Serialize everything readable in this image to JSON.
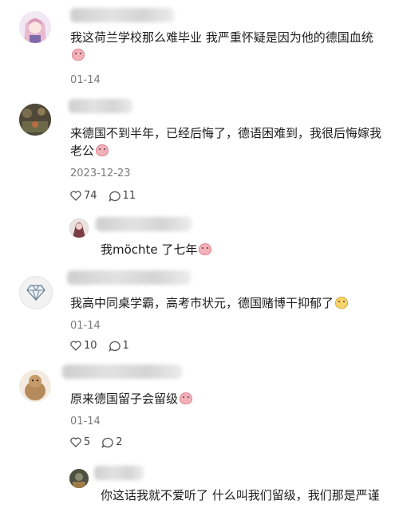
{
  "comments": [
    {
      "text": "我这荷兰学校那么难毕业 我严重怀疑是因为他的德国血统",
      "date": "01-14"
    },
    {
      "text": "来德国不到半年，已经后悔了，德语困难到，我很后悔嫁我老公",
      "date": "2023-12-23",
      "likes": "74",
      "replies": "11"
    },
    {
      "text": "我möchte 了七年"
    },
    {
      "text": "我高中同桌学霸，高考市状元，德国赌博干抑郁了",
      "date": "01-14",
      "likes": "10",
      "replies": "1"
    },
    {
      "text": "原来德国留子会留级",
      "date": "01-14",
      "likes": "5",
      "replies": "2"
    },
    {
      "text": "你这话我就不爱听了 什么叫我们留级，我们那是严谨"
    }
  ],
  "icons": [
    "anime-avatar-icon",
    "diamond-icon",
    "heart-icon",
    "reply-bubble-icon",
    "emoji-icon"
  ],
  "colors": {
    "date": "#7a7a7a",
    "text": "#1c1c1c",
    "blur": "#d6d6d6"
  }
}
